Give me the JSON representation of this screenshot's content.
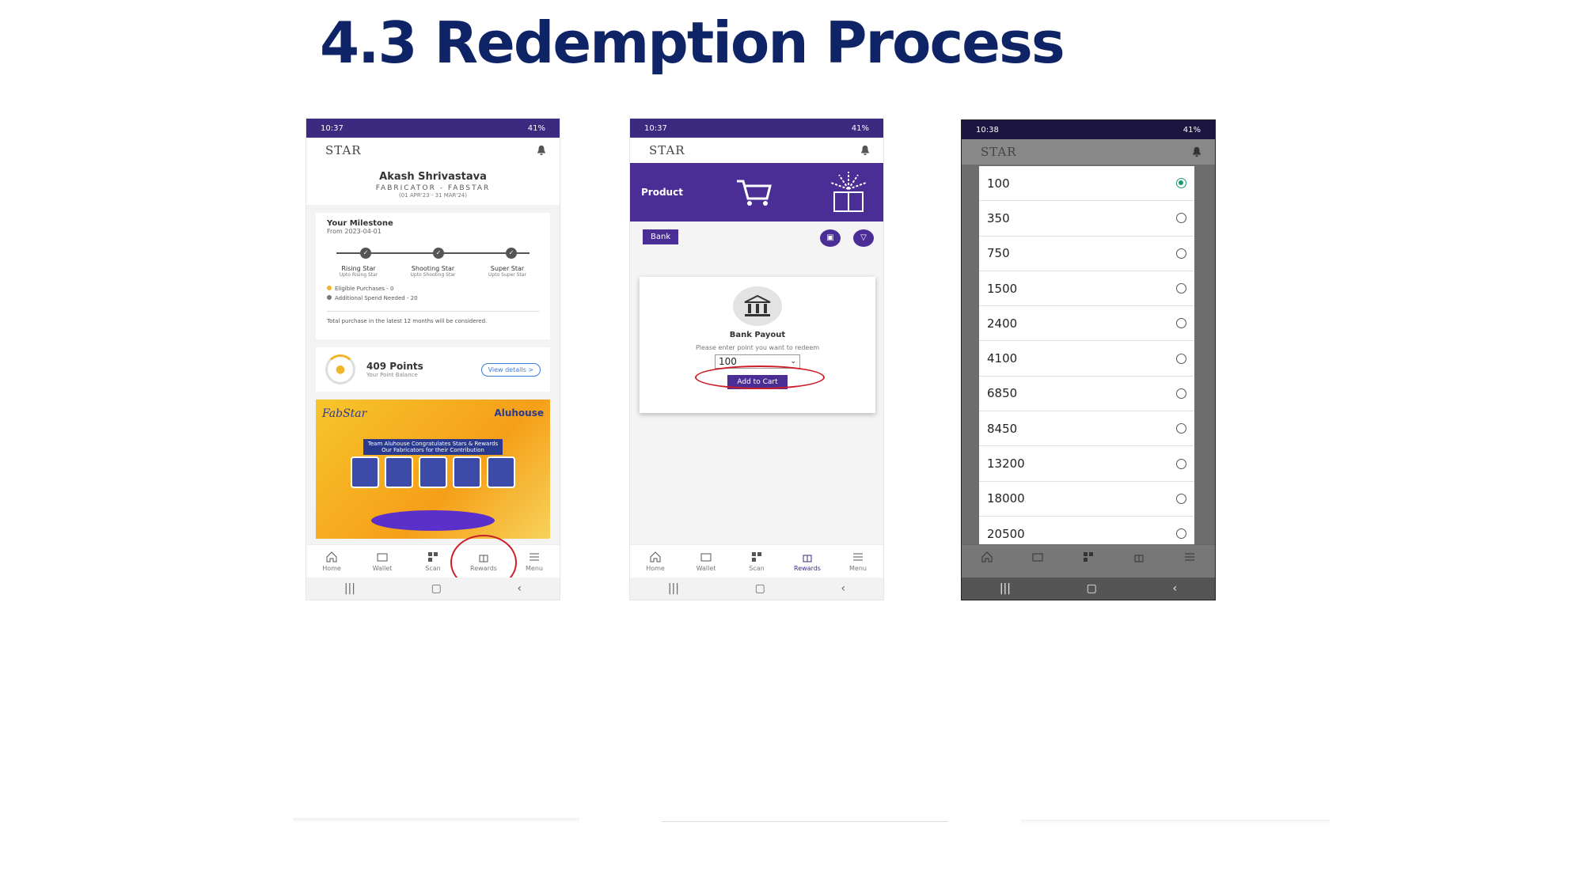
{
  "slide": {
    "title": "4.3 Redemption Process"
  },
  "phone1": {
    "status_time": "10:37",
    "status_right": "41%",
    "logo": "STAR",
    "profile": {
      "name": "Akash Shrivastava",
      "role": "FABRICATOR - FABSTAR",
      "date": "(01 APR'23 - 31 MAR'24)"
    },
    "milestone": {
      "title": "Your Milestone",
      "from": "From 2023-04-01",
      "stages": [
        {
          "name": "Rising Star",
          "sub": "Upto Rising Star"
        },
        {
          "name": "Shooting Star",
          "sub": "Upto Shooting Star"
        },
        {
          "name": "Super Star",
          "sub": "Upto Super Star"
        }
      ],
      "legend1": "Eligible Purchases - 0",
      "legend2": "Additional Spend Needed - 20",
      "note": "Total purchase in the latest 12 months will be considered."
    },
    "points": {
      "value": "409 Points",
      "sub": "Your Point Balance",
      "button": "View details >"
    },
    "banner": {
      "logo": "FabStar",
      "brand": "Aluhouse",
      "text": "Team Aluhouse Congratulates Stars & Rewards Our Fabricators for their Contribution"
    },
    "nav": [
      "Home",
      "Wallet",
      "Scan",
      "Rewards",
      "Menu"
    ]
  },
  "phone2": {
    "status_time": "10:37",
    "status_right": "41%",
    "logo": "STAR",
    "header_label": "Product",
    "tab": "Bank",
    "card": {
      "title": "Bank Payout",
      "hint": "Please enter point you want to redeem",
      "value": "100",
      "button": "Add to Cart"
    },
    "nav": [
      "Home",
      "Wallet",
      "Scan",
      "Rewards",
      "Menu"
    ]
  },
  "phone3": {
    "status_time": "10:38",
    "status_right": "41%",
    "logo": "STAR",
    "options": [
      "100",
      "350",
      "750",
      "1500",
      "2400",
      "4100",
      "6850",
      "8450",
      "13200",
      "18000",
      "20500"
    ],
    "selected": "100",
    "nav": [
      "Home",
      "Wallet",
      "Scan",
      "Rewards",
      "Menu"
    ]
  },
  "colors": {
    "title": "#0f2467",
    "primary": "#4b2d96",
    "highlight": "#cc1f2a",
    "radio_on": "#1a9a6b"
  }
}
